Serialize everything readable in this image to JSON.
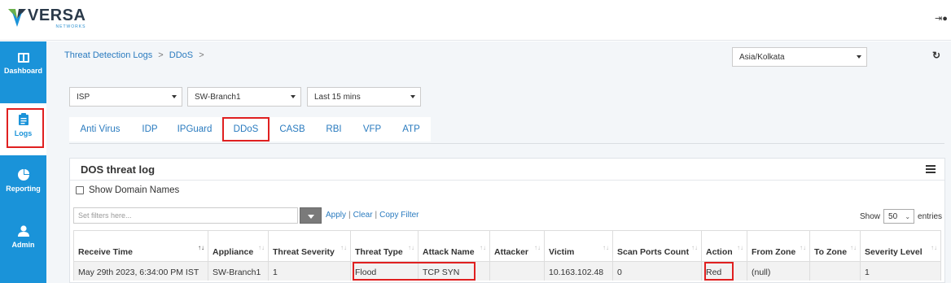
{
  "brand": {
    "name": "VERSA",
    "subtitle": "NETWORKS",
    "colors": {
      "green": "#6ab04c",
      "blue": "#1a93d9",
      "dark": "#2b3a4a"
    }
  },
  "header": {
    "logout_icon": "sign-out-icon"
  },
  "sidebar": {
    "items": [
      {
        "label": "Dashboard",
        "icon": "dashboard-icon"
      },
      {
        "label": "Logs",
        "icon": "clipboard-icon",
        "active": true
      },
      {
        "label": "Reporting",
        "icon": "pie-chart-icon"
      },
      {
        "label": "Admin",
        "icon": "user-icon"
      }
    ]
  },
  "breadcrumb": {
    "items": [
      "Threat Detection Logs",
      "DDoS"
    ],
    "separator": ">"
  },
  "timezone": {
    "value": "Asia/Kolkata"
  },
  "filters": {
    "tenant": "ISP",
    "appliance": "SW-Branch1",
    "range": "Last 15 mins"
  },
  "tabs": [
    "Anti Virus",
    "IDP",
    "IPGuard",
    "DDoS",
    "CASB",
    "RBI",
    "VFP",
    "ATP"
  ],
  "active_tab": "DDoS",
  "panel": {
    "title": "DOS threat log",
    "show_domain_names": "Show Domain Names",
    "filter_placeholder": "Set filters here...",
    "apply": "Apply",
    "clear": "Clear",
    "copy_filter": "Copy Filter",
    "show_label": "Show",
    "page_size": "50",
    "entries_label": "entries"
  },
  "table": {
    "columns": [
      "Receive Time",
      "Appliance",
      "Threat Severity",
      "Threat Type",
      "Attack Name",
      "Attacker",
      "Victim",
      "Scan Ports Count",
      "Action",
      "From Zone",
      "To Zone",
      "Severity Level"
    ],
    "rows": [
      [
        "May 29th 2023, 6:34:00 PM IST",
        "SW-Branch1",
        "1",
        "Flood",
        "TCP SYN",
        "",
        "10.163.102.48",
        "0",
        "Red",
        "(null)",
        "",
        "1"
      ]
    ]
  },
  "highlight_color": "#e02020"
}
